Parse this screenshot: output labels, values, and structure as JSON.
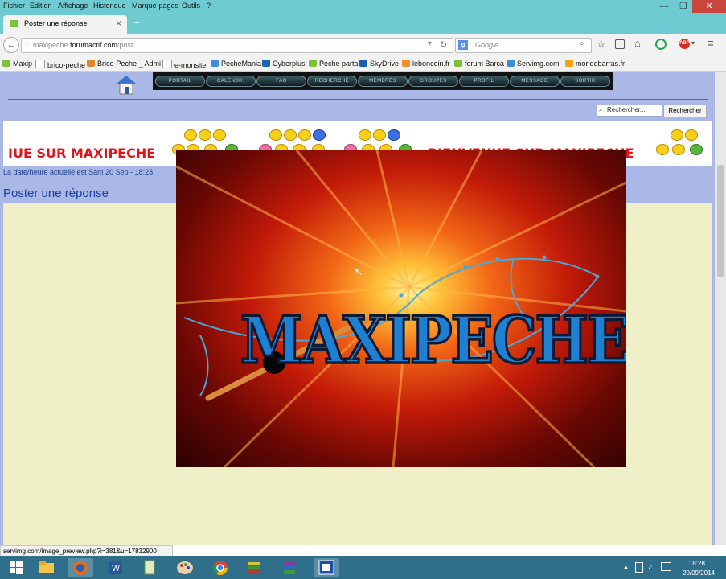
{
  "menubar": {
    "items": [
      "Fichier",
      "Édition",
      "Affichage",
      "Historique",
      "Marque-pages",
      "Outils",
      "?"
    ],
    "window_controls": {
      "minimize": "—",
      "maximize": "❐",
      "close": "✕"
    }
  },
  "tab": {
    "title": "Poster une réponse",
    "close": "×",
    "new_tab": "+"
  },
  "url": {
    "prefix": "maxipeche.",
    "domain": "forumactif.com",
    "path": "/post"
  },
  "search": {
    "engine_icon": "google-icon",
    "placeholder": "Google"
  },
  "bookmarks": [
    {
      "label": "Maxip",
      "color": "#7fbf3c"
    },
    {
      "label": "brico-peche",
      "color": "#ffffff"
    },
    {
      "label": "Brico-Peche _ Admi",
      "color": "#e0862b"
    },
    {
      "label": "e-monsite",
      "color": "#ffffff"
    },
    {
      "label": "PecheMania",
      "color": "#3c8fd6"
    },
    {
      "label": "Cyberplus",
      "color": "#1a63b0"
    },
    {
      "label": "Peche parta",
      "color": "#7fbf3c"
    },
    {
      "label": "SkyDrive",
      "color": "#1b5fb5"
    },
    {
      "label": "leboncoin.fr",
      "color": "#f48f28"
    },
    {
      "label": "forum Barca",
      "color": "#7fbf3c"
    },
    {
      "label": "Servimg.com",
      "color": "#3a8fd4"
    },
    {
      "label": "mondebarras.fr",
      "color": "#f4a21a"
    }
  ],
  "forum_nav": [
    "PORTAIL",
    "CALENDR.",
    "FAQ",
    "RECHERCHE",
    "MEMBRES",
    "GROUPES",
    "PROFIL",
    "MESSAGE",
    "SORTIR"
  ],
  "forum_search": {
    "placeholder": "Rechercher...",
    "button": "Rechercher"
  },
  "banner": {
    "text_left": "IUE SUR MAXIPECHE",
    "text_right": "BIENVENUE SUR MAXIPECHE"
  },
  "date_line": "La date/heure actuelle est Sam 20 Sep - 18:28",
  "page_title": "Poster une réponse",
  "hero_image": {
    "title": "MAXIPECHE"
  },
  "status_url": "servimg.com/image_preview.php?i=381&u=17832900",
  "taskbar": {
    "apps": [
      "start-icon",
      "file-explorer-icon",
      "firefox-icon",
      "word-icon",
      "notes-icon",
      "paint-icon",
      "chrome-icon",
      "books-icon",
      "winrar-icon",
      "app-icon"
    ],
    "time": "18:28",
    "date": "20/09/2014"
  },
  "colors": {
    "chrome": "#6fcbd2",
    "page_bg": "#a9b8e6",
    "content_bg": "#efefc8",
    "banner_text": "#e0151b",
    "title_blue": "#1b3fa0"
  }
}
